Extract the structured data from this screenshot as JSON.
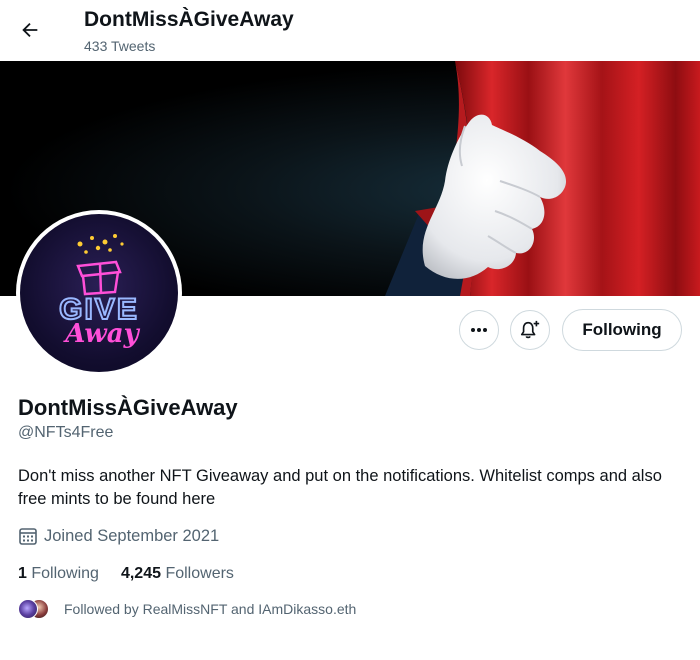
{
  "header": {
    "title": "DontMissÀGiveAway",
    "tweet_count": "433 Tweets"
  },
  "banner": {
    "description": "black curtain background with white-gloved hand pulling back red curtain"
  },
  "avatar": {
    "line1": "GIVE",
    "line2": "Away"
  },
  "actions": {
    "more_icon": "more-dots-icon",
    "notify_icon": "bell-plus-icon",
    "following_label": "Following"
  },
  "profile": {
    "name": "DontMissÀGiveAway",
    "handle": "@NFTs4Free",
    "bio": "Don't miss another NFT Giveaway and put on the notifications. Whitelist comps and also free mints to be found here",
    "joined": "Joined September 2021",
    "following_count": "1",
    "following_label": "Following",
    "followers_count": "4,245",
    "followers_label": "Followers",
    "followed_by": "Followed by RealMissNFT and IAmDikasso.eth"
  },
  "colors": {
    "text_primary": "#0f1419",
    "text_secondary": "#536471",
    "border": "#cfd9de",
    "curtain_red": "#c81a1e"
  }
}
